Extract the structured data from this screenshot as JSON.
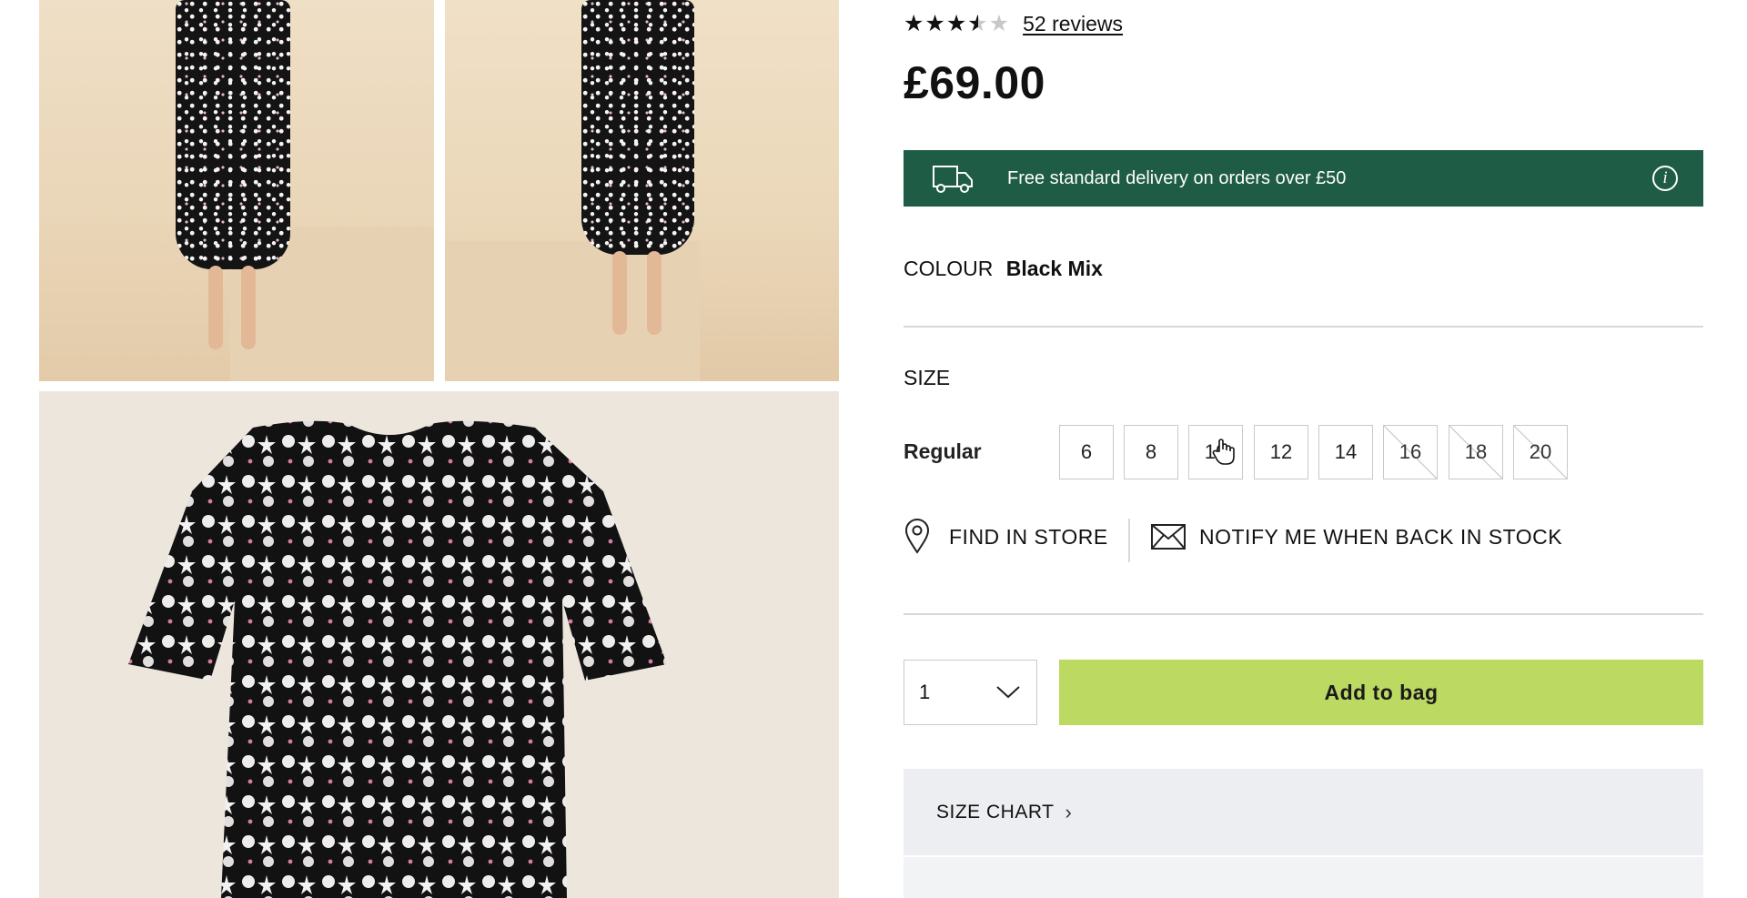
{
  "product": {
    "rating": 3.5,
    "reviews_label": "52 reviews",
    "price": "£69.00"
  },
  "delivery": {
    "text": "Free standard delivery on orders over £50",
    "info_glyph": "i",
    "color": "#1e5c45"
  },
  "colour": {
    "label": "COLOUR",
    "value": "Black Mix"
  },
  "size": {
    "heading": "SIZE",
    "fit_label": "Regular",
    "options": [
      {
        "label": "6",
        "available": true
      },
      {
        "label": "8",
        "available": true
      },
      {
        "label": "10",
        "available": true,
        "hovered": true
      },
      {
        "label": "12",
        "available": true
      },
      {
        "label": "14",
        "available": true
      },
      {
        "label": "16",
        "available": false
      },
      {
        "label": "18",
        "available": false
      },
      {
        "label": "20",
        "available": false
      }
    ]
  },
  "actions": {
    "find_in_store": "FIND IN STORE",
    "notify": "NOTIFY ME WHEN BACK IN STOCK"
  },
  "purchase": {
    "quantity": "1",
    "add_to_bag": "Add to bag",
    "button_color": "#bcd962"
  },
  "size_chart": {
    "label": "SIZE CHART",
    "chevron": "›"
  }
}
